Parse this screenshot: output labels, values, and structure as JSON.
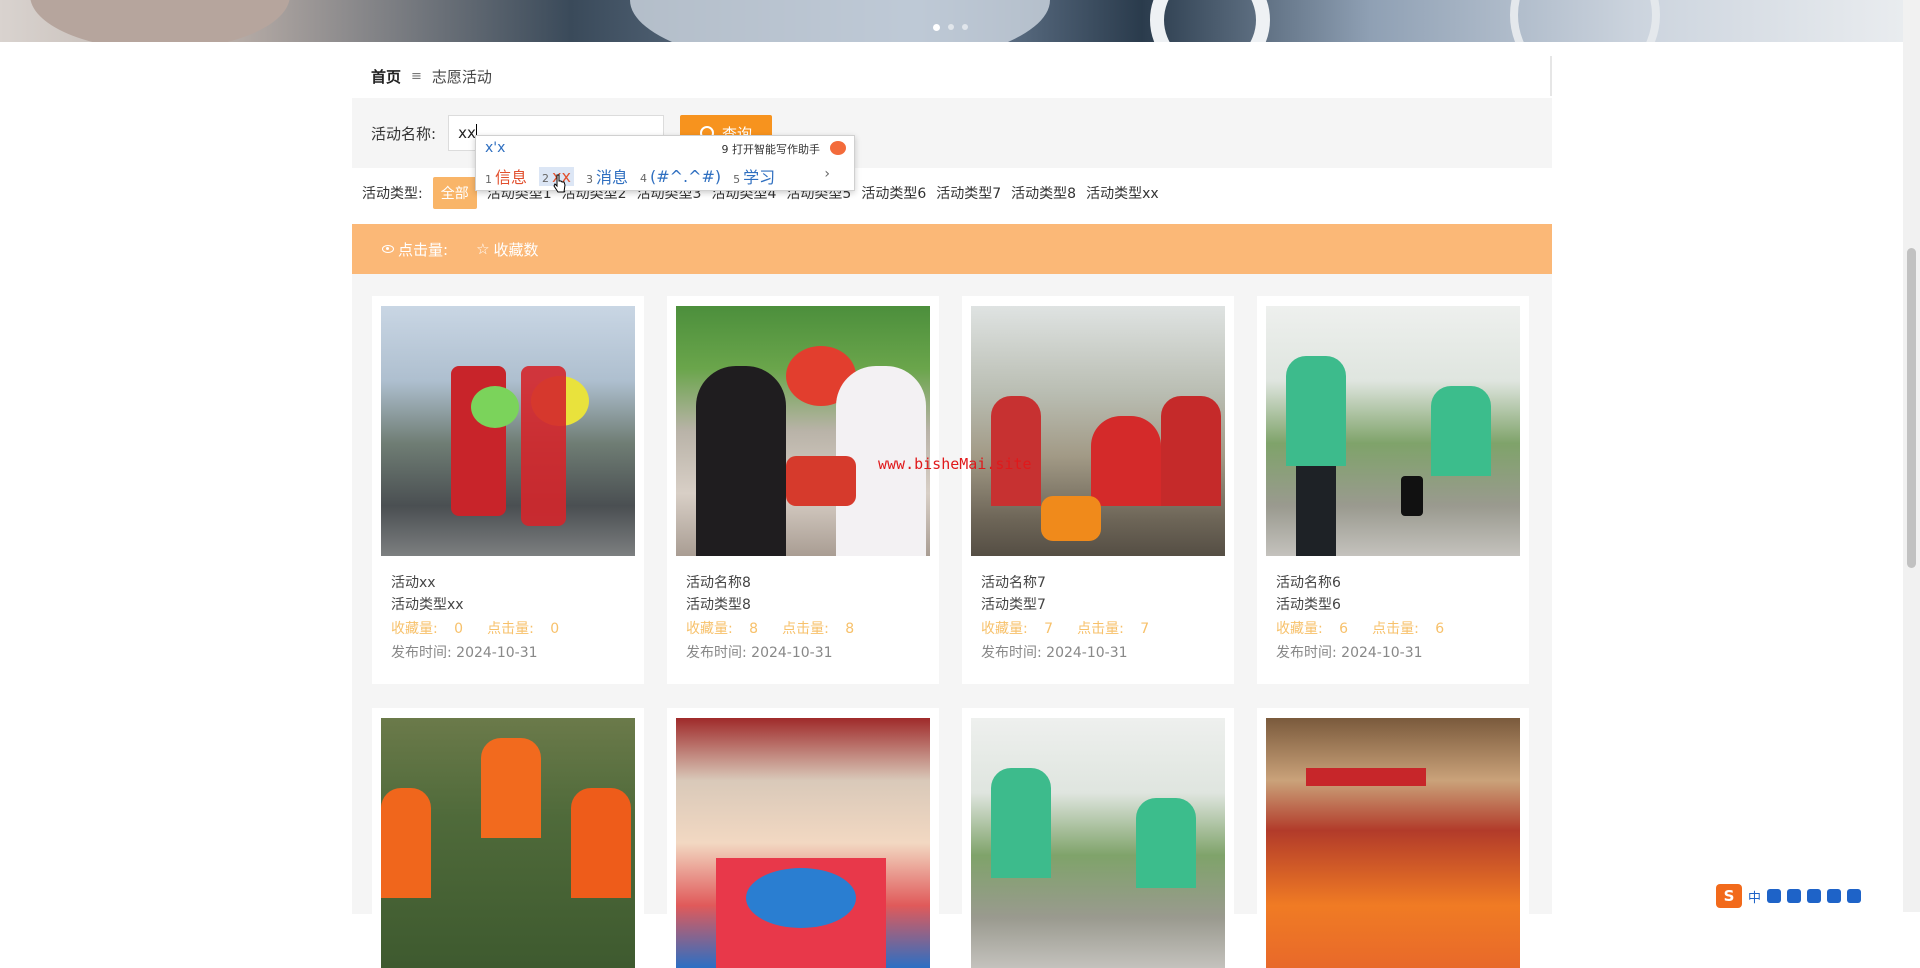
{
  "breadcrumb": {
    "home": "首页",
    "separator": "≡",
    "current": "志愿活动"
  },
  "search": {
    "label": "活动名称:",
    "value": "xx",
    "button": "查询"
  },
  "ime": {
    "pinyin": "x'x",
    "assist": "9 打开智能写作助手",
    "candidates": [
      {
        "n": "1",
        "text": "信息"
      },
      {
        "n": "2",
        "text": "xx"
      },
      {
        "n": "3",
        "text": "消息"
      },
      {
        "n": "4",
        "text": "(#^.^#)"
      },
      {
        "n": "5",
        "text": "学习"
      }
    ],
    "more": "›"
  },
  "types": {
    "label": "活动类型:",
    "items": [
      "全部",
      "活动类型1",
      "活动类型2",
      "活动类型3",
      "活动类型4",
      "活动类型5",
      "活动类型6",
      "活动类型7",
      "活动类型8",
      "活动类型xx"
    ]
  },
  "sort": {
    "clicks": "点击量:",
    "favorites": "收藏数"
  },
  "cards": [
    {
      "title": "活动xx",
      "type": "活动类型xx",
      "fav_label": "收藏量:",
      "fav": "0",
      "click_label": "点击量:",
      "click": "0",
      "date_label": "发布时间:",
      "date": "2024-10-31"
    },
    {
      "title": "活动名称8",
      "type": "活动类型8",
      "fav_label": "收藏量:",
      "fav": "8",
      "click_label": "点击量:",
      "click": "8",
      "date_label": "发布时间:",
      "date": "2024-10-31"
    },
    {
      "title": "活动名称7",
      "type": "活动类型7",
      "fav_label": "收藏量:",
      "fav": "7",
      "click_label": "点击量:",
      "click": "7",
      "date_label": "发布时间:",
      "date": "2024-10-31"
    },
    {
      "title": "活动名称6",
      "type": "活动类型6",
      "fav_label": "收藏量:",
      "fav": "6",
      "click_label": "点击量:",
      "click": "6",
      "date_label": "发布时间:",
      "date": "2024-10-31"
    }
  ],
  "watermark": "www.bisheMai.site",
  "taskbar": {
    "ime_logo": "S",
    "lang": "中"
  },
  "colors": {
    "accent": "#f7931e",
    "sortbar": "#fbb877",
    "stats": "#f7c16b",
    "type_active": "#f9b568"
  }
}
